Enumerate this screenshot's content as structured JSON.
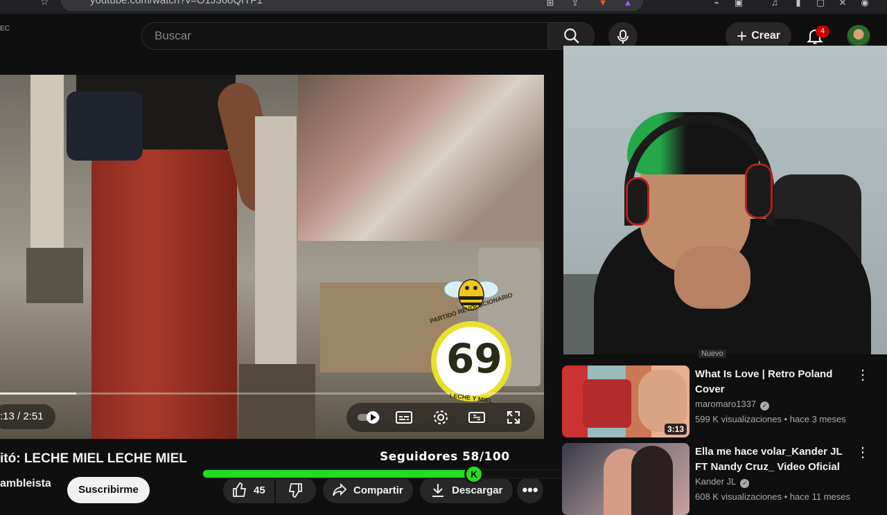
{
  "browser": {
    "url": "youtube.com/watch?v=O1J36oQfTF1"
  },
  "header": {
    "region": "EC",
    "search_placeholder": "Buscar",
    "create_label": "Crear",
    "notification_count": "4"
  },
  "player": {
    "time": ":13 / 2:51",
    "progress_fraction": 0.04,
    "logo_number": "69",
    "logo_arc_text": "PARTIDO REVOLUCIONARIO",
    "logo_bottom_text": "LECHE Y MIEL"
  },
  "video": {
    "title": "itó: LECHE MIEL LECHE MIEL",
    "channel": "ambleista",
    "subscribe_label": "Suscribirme",
    "likes": "45",
    "share_label": "Compartir",
    "download_label": "Descargar"
  },
  "overlay": {
    "followers_text": "Seguidores 58/100",
    "followers_current": 58,
    "followers_goal": 100,
    "knob_letter": "K"
  },
  "recommendations": [
    {
      "badge": "Nuevo",
      "title": "What Is Love | Retro Poland Cover",
      "channel": "maromaro1337",
      "meta": "599 K visualizaciones • hace 3 meses",
      "duration": "3:13"
    },
    {
      "title": "Ella me hace volar_Kander JL FT Nandy Cruz_ Video Oficial",
      "channel": "Kander JL",
      "meta": "608 K visualizaciones • hace 11 meses"
    }
  ],
  "colors": {
    "background": "#0f0f0f",
    "follow_bar": "#22dd22",
    "notification_badge": "#cc0000",
    "logo_ring": "#e9e02a"
  }
}
